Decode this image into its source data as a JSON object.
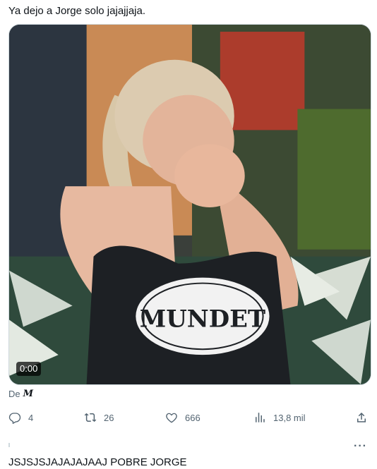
{
  "tweet": {
    "text": "Ya dejo a Jorge solo jajajjaja."
  },
  "media": {
    "time": "0:00",
    "shirt_text": "MUNDET"
  },
  "attribution": {
    "prefix": "De",
    "source": "M"
  },
  "actions": {
    "replies": "4",
    "retweets": "26",
    "likes": "666",
    "views": "13,8 mil"
  },
  "reply": {
    "more": "···",
    "text": "JSJSJSJAJAJAJAAJ POBRE JORGE"
  },
  "icons": {
    "reply": "reply-icon",
    "retweet": "retweet-icon",
    "like": "heart-icon",
    "views": "views-icon",
    "share": "share-icon",
    "more": "more-icon"
  },
  "colors": {
    "text": "#0f1419",
    "secondary": "#536471",
    "border": "#cfd9de"
  }
}
